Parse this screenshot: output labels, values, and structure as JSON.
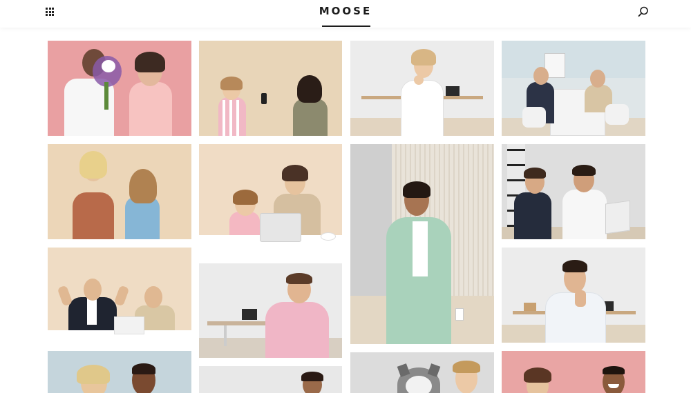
{
  "header": {
    "logo": "MOOSE",
    "menu_icon": "grid-menu-icon",
    "search_icon": "search-icon"
  },
  "colors": {
    "pink": "#e9a0a2",
    "beige": "#ecd8bd",
    "light_gray": "#ebebeb",
    "light_blue": "#c9d7dd",
    "peach": "#efdcc6",
    "text_dark": "#1c1c1c"
  },
  "gallery": {
    "tiles": [
      {
        "name": "photo-couple-flowers",
        "bg": "#e9a0a2"
      },
      {
        "name": "photo-girl-selfie",
        "bg": "#e8d5b8"
      },
      {
        "name": "photo-woman-punch",
        "bg": "#ececec"
      },
      {
        "name": "photo-office-meeting",
        "bg": "#d3e0e5"
      },
      {
        "name": "photo-women-laughing",
        "bg": "#ecd6b8"
      },
      {
        "name": "photo-girl-laptop",
        "bg": "#f0dcc5"
      },
      {
        "name": "photo-woman-mint-suit",
        "bg": "#e6e4e0"
      },
      {
        "name": "photo-men-laptop-office",
        "bg": "#dedede"
      },
      {
        "name": "photo-business-shrug",
        "bg": "#efdcc4"
      },
      {
        "name": "photo-man-pink-robe",
        "bg": "#ebebeb"
      },
      {
        "name": "photo-man-thinking",
        "bg": "#ececec"
      },
      {
        "name": "photo-couple-facepalm",
        "bg": "#c5d5dc"
      },
      {
        "name": "photo-man-partial",
        "bg": "#e8e8e8"
      },
      {
        "name": "photo-girl-husky",
        "bg": "#dcdcdc"
      },
      {
        "name": "photo-couple-pink",
        "bg": "#e9a5a4"
      }
    ]
  }
}
